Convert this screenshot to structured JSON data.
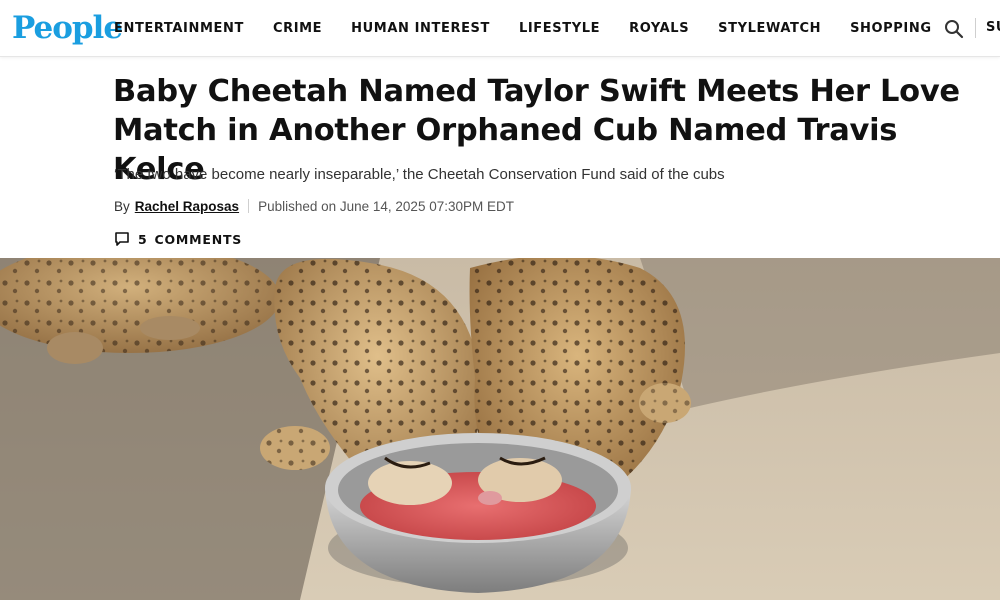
{
  "header": {
    "logo": "People",
    "nav": [
      "ENTERTAINMENT",
      "CRIME",
      "HUMAN INTEREST",
      "LIFESTYLE",
      "ROYALS",
      "STYLEWATCH",
      "SHOPPING"
    ],
    "subscribe_partial": "SU"
  },
  "article": {
    "headline": "Baby Cheetah Named Taylor Swift Meets Her Love Match in Another Orphaned Cub Named Travis Kelce",
    "dek": "‘The two have become nearly inseparable,’ the Cheetah Conservation Fund said of the cubs",
    "by_prefix": "By",
    "author": "Rachel Raposas",
    "published": "Published on June 14, 2025 07:30PM EDT",
    "comments_count": "5",
    "comments_label": "COMMENTS",
    "image_subject": "two-cheetah-cubs-drinking-from-bowl"
  },
  "colors": {
    "brand": "#1a9ee0",
    "text": "#111111"
  }
}
